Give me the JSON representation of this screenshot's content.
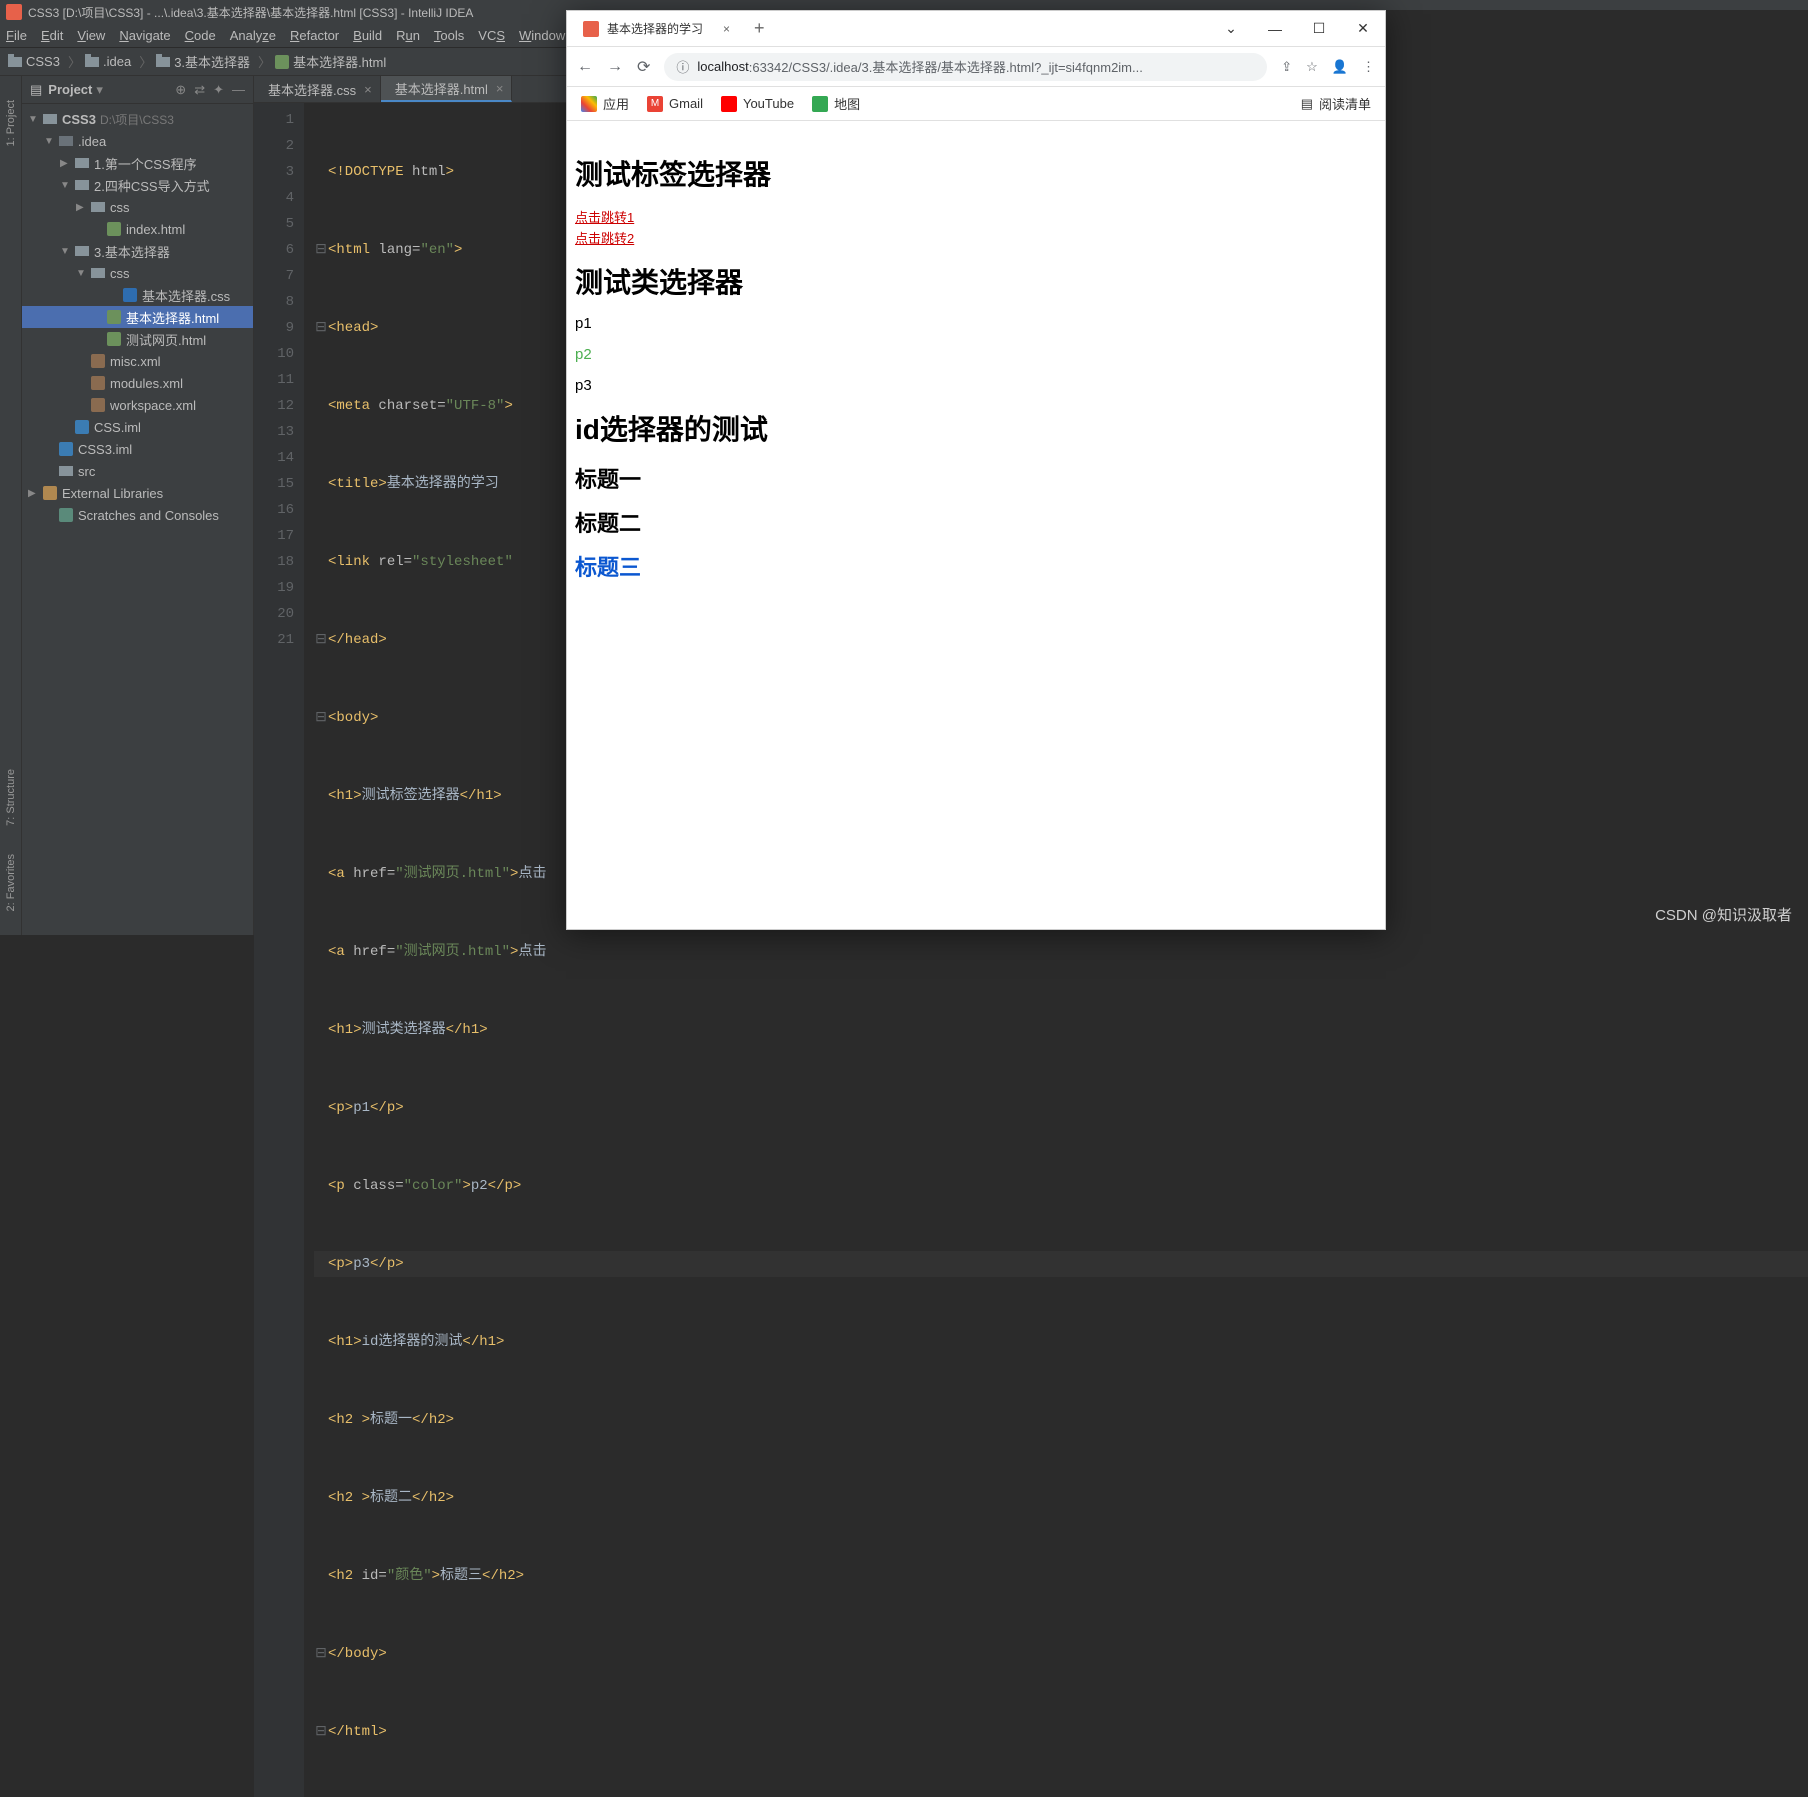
{
  "window": {
    "title": "CSS3 [D:\\项目\\CSS3] - ...\\.idea\\3.基本选择器\\基本选择器.html [CSS3] - IntelliJ IDEA"
  },
  "menu": {
    "file": "File",
    "edit": "Edit",
    "view": "View",
    "navigate": "Navigate",
    "code": "Code",
    "analyze": "Analyze",
    "refactor": "Refactor",
    "build": "Build",
    "run": "Run",
    "tools": "Tools",
    "vcs": "VCS",
    "window": "Window"
  },
  "breadcrumb": {
    "root": "CSS3",
    "p1": ".idea",
    "p2": "3.基本选择器",
    "file": "基本选择器.html"
  },
  "left_rail": {
    "project": "1: Project",
    "structure": "7: Structure",
    "favorites": "2: Favorites"
  },
  "project": {
    "label": "Project",
    "root": "CSS3",
    "root_path": "D:\\项目\\CSS3",
    "idea": ".idea",
    "d1": "1.第一个CSS程序",
    "d2": "2.四种CSS导入方式",
    "d2_css": "css",
    "d2_index": "index.html",
    "d3": "3.基本选择器",
    "d3_css": "css",
    "d3_css_file": "基本选择器.css",
    "d3_html": "基本选择器.html",
    "d3_test": "测试网页.html",
    "misc": "misc.xml",
    "modules": "modules.xml",
    "workspace": "workspace.xml",
    "css_iml": "CSS.iml",
    "css3_iml": "CSS3.iml",
    "src": "src",
    "ext_lib": "External Libraries",
    "scratches": "Scratches and Consoles"
  },
  "tabs": {
    "css": "基本选择器.css",
    "html": "基本选择器.html"
  },
  "gutter": [
    "1",
    "2",
    "3",
    "4",
    "5",
    "6",
    "7",
    "8",
    "9",
    "10",
    "11",
    "12",
    "13",
    "14",
    "15",
    "16",
    "17",
    "18",
    "19",
    "20",
    "21"
  ],
  "code": {
    "l1a": "<!DOCTYPE ",
    "l1b": "html",
    "l1c": ">",
    "l2a": "<html ",
    "l2b": "lang=",
    "l2c": "\"en\"",
    "l2d": ">",
    "l3": "<head>",
    "l4a": "<meta ",
    "l4b": "charset=",
    "l4c": "\"UTF-8\"",
    "l4d": ">",
    "l5a": "<title>",
    "l5b": "基本选择器的学习",
    "l5c": "",
    "l6a": "<link ",
    "l6b": "rel=",
    "l6c": "\"stylesheet\"",
    "l7": "</head>",
    "l8": "<body>",
    "l9a": "<h1>",
    "l9b": "测试标签选择器",
    "l9c": "</h1>",
    "l10a": "<a ",
    "l10b": "href=",
    "l10c": "\"测试网页.html\"",
    "l10d": ">",
    "l10e": "点击",
    "l11a": "<a ",
    "l11b": "href=",
    "l11c": "\"测试网页.html\"",
    "l11d": ">",
    "l11e": "点击",
    "l12a": "<h1>",
    "l12b": "测试类选择器",
    "l12c": "</h1>",
    "l13a": "<p>",
    "l13b": "p1",
    "l13c": "</p>",
    "l14a": "<p ",
    "l14b": "class=",
    "l14c": "\"color\"",
    "l14d": ">",
    "l14e": "p2",
    "l14f": "</p>",
    "l15a": "<p>",
    "l15b": "p3",
    "l15c": "</p>",
    "l16a": "<h1>",
    "l16b": "id选择器的测试",
    "l16c": "</h1>",
    "l17a": "<h2 >",
    "l17b": "标题一",
    "l17c": "</h2>",
    "l18a": "<h2 >",
    "l18b": "标题二",
    "l18c": "</h2>",
    "l19a": "<h2 ",
    "l19b": "id=",
    "l19c": "\"颜色\"",
    "l19d": ">",
    "l19e": "标题三",
    "l19f": "</h2>",
    "l20": "</body>",
    "l21": "</html>"
  },
  "browser": {
    "tab_title": "基本选择器的学习",
    "url_host": "localhost",
    "url_rest": ":63342/CSS3/.idea/3.基本选择器/基本选择器.html?_ijt=si4fqnm2im...",
    "bm_apps": "应用",
    "bm_gmail": "Gmail",
    "bm_youtube": "YouTube",
    "bm_maps": "地图",
    "reading_list": "阅读清单",
    "h1a": "测试标签选择器",
    "link1": "点击跳转1",
    "link2": "点击跳转2",
    "h1b": "测试类选择器",
    "p1": "p1",
    "p2": "p2",
    "p3": "p3",
    "h1c": "id选择器的测试",
    "h2a": "标题一",
    "h2b": "标题二",
    "h2c": "标题三"
  },
  "watermark": "CSDN @知识汲取者"
}
